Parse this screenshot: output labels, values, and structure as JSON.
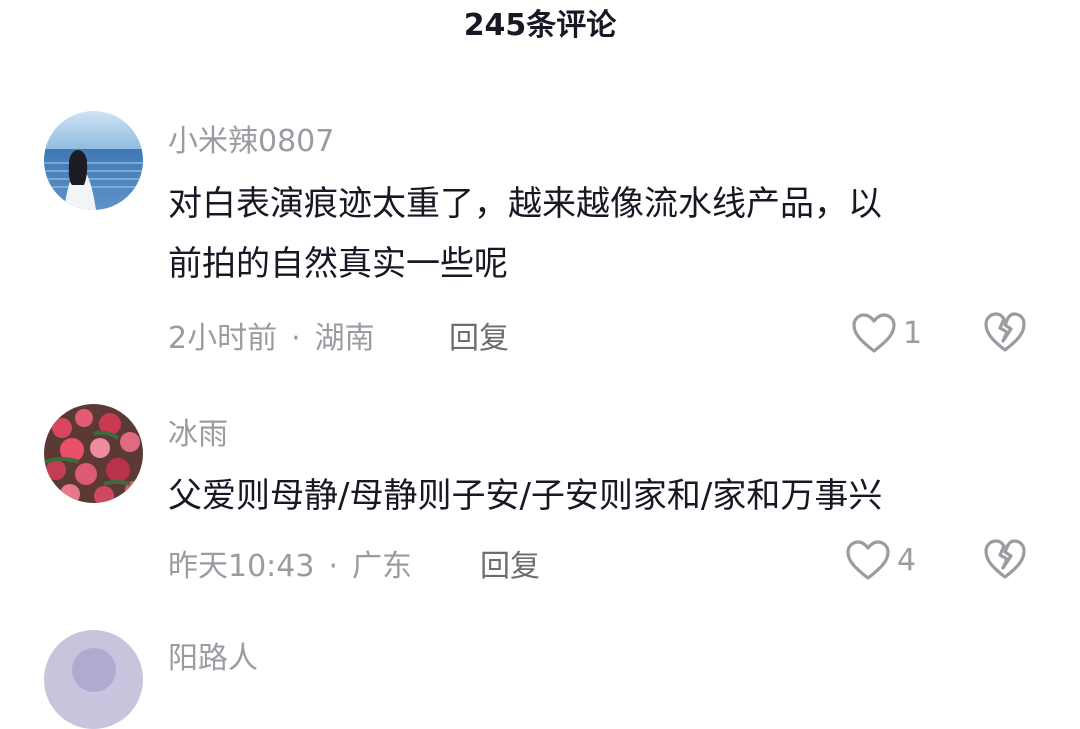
{
  "header": {
    "title": "245条评论"
  },
  "comments": [
    {
      "username": "小米辣0807",
      "text_line1": "对白表演痕迹太重了，越来越像流水线产品，以",
      "text_line2": "前拍的自然真实一些呢",
      "time": "2小时前",
      "location": "湖南",
      "reply_label": "回复",
      "likes": "1",
      "avatar_icon": "girl-seaside-avatar"
    },
    {
      "username": "冰雨",
      "text_line1": "父爱则母静/母静则子安/子安则家和/家和万事兴",
      "time": "昨天10:43",
      "location": "广东",
      "reply_label": "回复",
      "likes": "4",
      "avatar_icon": "flowers-avatar"
    }
  ],
  "partial_comment": {
    "username": "阳路人"
  },
  "separator": "·",
  "colors": {
    "text": "#161823",
    "muted": "#9b9ba2",
    "reply": "#6c6c73"
  }
}
